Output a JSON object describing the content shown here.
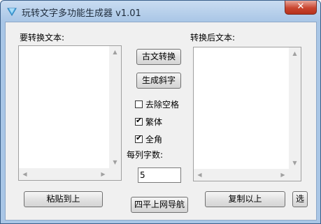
{
  "window": {
    "title": "玩转文字多功能生成器 v1.01",
    "close_symbol": "✕"
  },
  "left_pane": {
    "label": "要转换文本:",
    "text": ""
  },
  "right_pane": {
    "label": "转换后文本:",
    "text": ""
  },
  "buttons": {
    "classical": "古文转换",
    "italic": "生成斜字",
    "paste": "粘贴到上",
    "nav": "四平上网导航",
    "copy": "复制以上",
    "select": "选"
  },
  "options": {
    "remove_spaces": {
      "label": "去除空格",
      "checked": false
    },
    "traditional": {
      "label": "繁体",
      "checked": true
    },
    "fullwidth": {
      "label": "全角",
      "checked": true
    }
  },
  "chars_per_column": {
    "label": "每列字数:",
    "value": "5"
  },
  "scroll_arrows": {
    "up": "▲",
    "down": "▼",
    "left": "◀",
    "right": "▶"
  },
  "check_mark": "✔",
  "colors": {
    "frame": "#a9c6e6",
    "close": "#c9452f"
  }
}
